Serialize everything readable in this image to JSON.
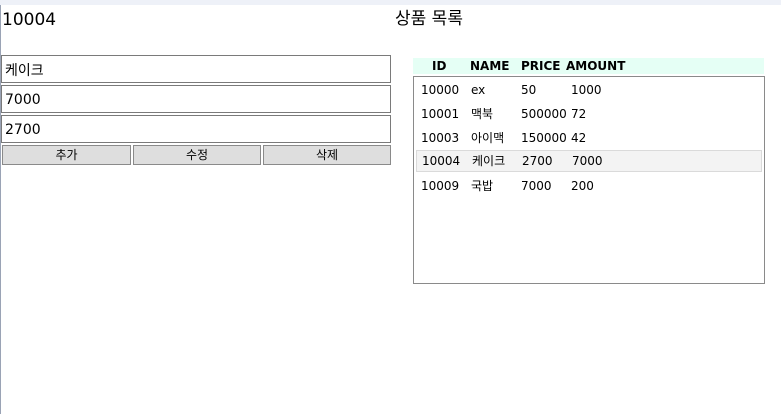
{
  "header": {
    "selected_id": "10004",
    "title": "상품 목록"
  },
  "form": {
    "name_value": "케이크",
    "price_value": "7000",
    "amount_value": "2700"
  },
  "buttons": {
    "add": "추가",
    "edit": "수정",
    "delete": "삭제"
  },
  "table": {
    "columns": {
      "id": "ID",
      "name": "NAME",
      "price": "PRICE",
      "amount": "AMOUNT"
    },
    "rows": [
      {
        "id": "10000",
        "name": "ex",
        "price": "50",
        "amount": "1000"
      },
      {
        "id": "10001",
        "name": "맥북",
        "price": "500000",
        "amount": "72"
      },
      {
        "id": "10003",
        "name": "아이맥",
        "price": "150000",
        "amount": "42"
      },
      {
        "id": "10004",
        "name": "케이크",
        "price": "2700",
        "amount": "7000"
      },
      {
        "id": "10009",
        "name": "국밥",
        "price": "7000",
        "amount": "200"
      }
    ],
    "header_color": "#e5fff5",
    "selected_row_color": "#f3f3f3"
  }
}
